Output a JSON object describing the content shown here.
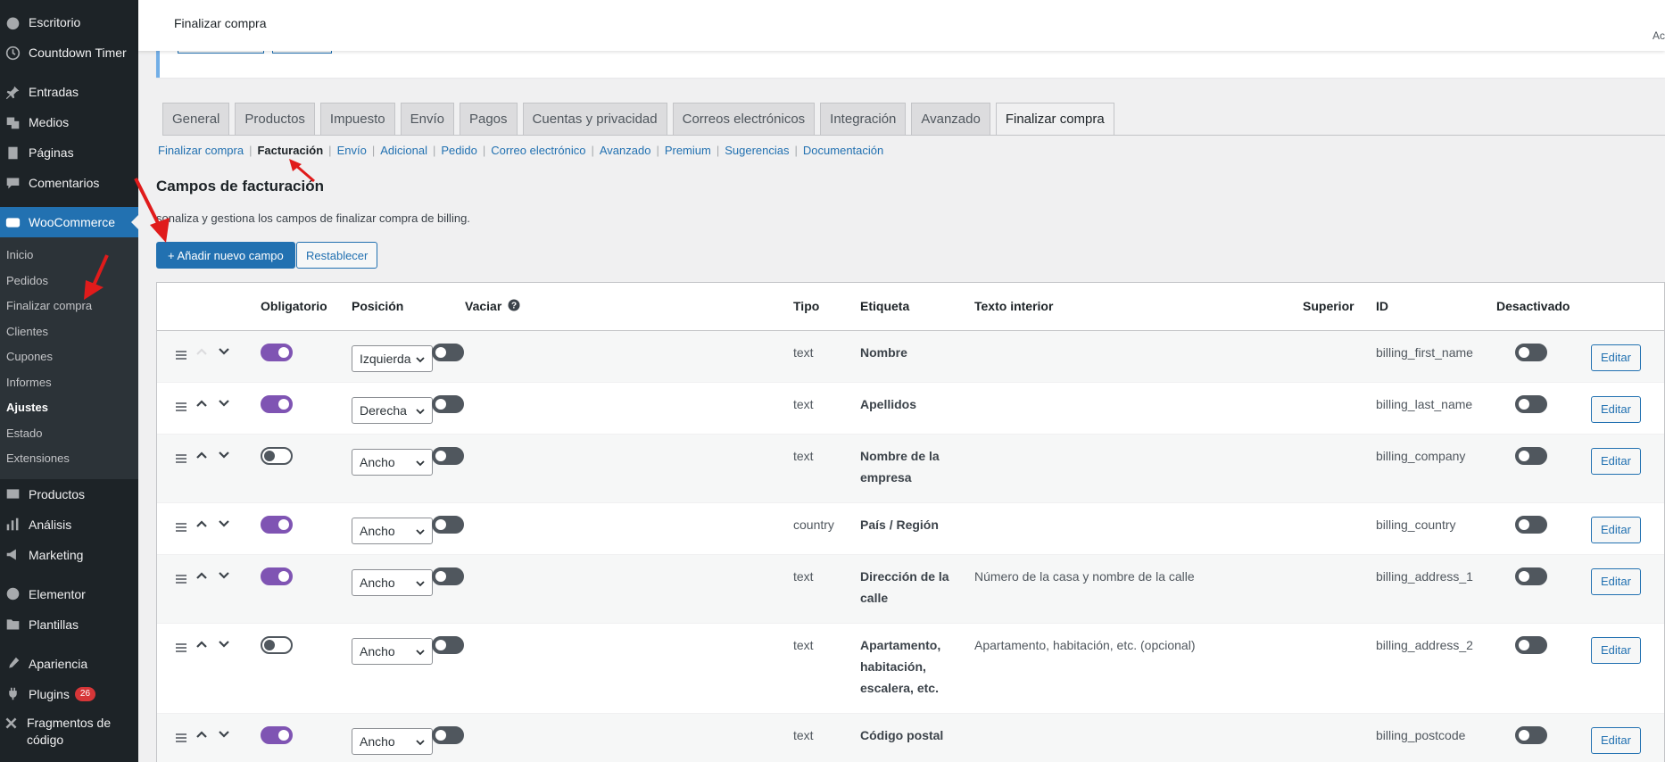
{
  "sidebar": {
    "items_top": [
      {
        "label": "Escritorio",
        "icon": "dashboard-icon"
      },
      {
        "label": "Countdown Timer",
        "icon": "clock-icon"
      }
    ],
    "items_content": [
      {
        "label": "Entradas",
        "icon": "pin-icon"
      },
      {
        "label": "Medios",
        "icon": "media-icon"
      },
      {
        "label": "Páginas",
        "icon": "pages-icon"
      },
      {
        "label": "Comentarios",
        "icon": "comments-icon"
      }
    ],
    "woocommerce_label": "WooCommerce",
    "woocommerce_sub": [
      "Inicio",
      "Pedidos",
      "Finalizar compra",
      "Clientes",
      "Cupones",
      "Informes",
      "Ajustes",
      "Estado",
      "Extensiones"
    ],
    "items_after": [
      {
        "label": "Productos",
        "icon": "products-icon"
      },
      {
        "label": "Análisis",
        "icon": "analytics-icon"
      },
      {
        "label": "Marketing",
        "icon": "marketing-icon"
      }
    ],
    "items_bottom": [
      {
        "label": "Elementor",
        "icon": "elementor-icon"
      },
      {
        "label": "Plantillas",
        "icon": "templates-icon"
      }
    ],
    "items_tools": [
      {
        "label": "Apariencia",
        "icon": "appearance-icon"
      },
      {
        "label": "Plugins",
        "icon": "plugins-icon",
        "badge": "26"
      },
      {
        "label": "Fragmentos de código",
        "icon": "snippets-icon"
      }
    ]
  },
  "header": {
    "title": "Finalizar compra",
    "right_text": "Ac"
  },
  "tabs": [
    "General",
    "Productos",
    "Impuesto",
    "Envío",
    "Pagos",
    "Cuentas y privacidad",
    "Correos electrónicos",
    "Integración",
    "Avanzado",
    "Finalizar compra"
  ],
  "subnav": [
    "Finalizar compra",
    "Facturación",
    "Envío",
    "Adicional",
    "Pedido",
    "Correo electrónico",
    "Avanzado",
    "Premium",
    "Sugerencias",
    "Documentación"
  ],
  "section": {
    "title": "Campos de facturación",
    "description": "sonaliza y gestiona los campos de finalizar compra de billing.",
    "add_button": "+ Añadir nuevo campo",
    "reset_button": "Restablecer"
  },
  "table": {
    "headers": {
      "required": "Obligatorio",
      "position": "Posición",
      "clear": "Vaciar",
      "type": "Tipo",
      "label": "Etiqueta",
      "placeholder": "Texto interior",
      "superior": "Superior",
      "id": "ID",
      "disabled": "Desactivado"
    },
    "edit_label": "Editar",
    "rows": [
      {
        "required": true,
        "position": "Izquierda",
        "type": "text",
        "label": "Nombre",
        "placeholder": "",
        "id": "billing_first_name"
      },
      {
        "required": true,
        "position": "Derecha",
        "type": "text",
        "label": "Apellidos",
        "placeholder": "",
        "id": "billing_last_name"
      },
      {
        "required": false,
        "position": "Ancho",
        "type": "text",
        "label": "Nombre de la empresa",
        "placeholder": "",
        "id": "billing_company"
      },
      {
        "required": true,
        "position": "Ancho",
        "type": "country",
        "label": "País / Región",
        "placeholder": "",
        "id": "billing_country"
      },
      {
        "required": true,
        "position": "Ancho",
        "type": "text",
        "label": "Dirección de la calle",
        "placeholder": "Número de la casa y nombre de la calle",
        "id": "billing_address_1"
      },
      {
        "required": false,
        "position": "Ancho",
        "type": "text",
        "label": "Apartamento, habitación, escalera, etc.",
        "placeholder": "Apartamento, habitación, etc. (opcional)",
        "id": "billing_address_2"
      },
      {
        "required": true,
        "position": "Ancho",
        "type": "text",
        "label": "Código postal",
        "placeholder": "",
        "id": "billing_postcode"
      }
    ]
  },
  "colors": {
    "accent": "#2271b1",
    "toggle_on": "#7f54b3",
    "sidebar": "#1d2327",
    "annotation": "#e01b1b"
  }
}
